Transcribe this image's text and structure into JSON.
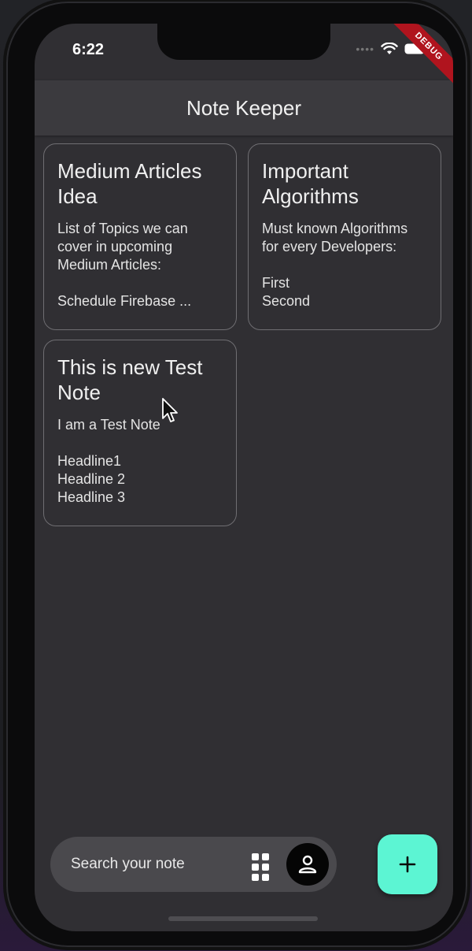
{
  "status_bar": {
    "time": "6:22",
    "debug_label": "DEBUG"
  },
  "app_bar": {
    "title": "Note Keeper"
  },
  "notes": [
    {
      "title": "Medium Articles Idea",
      "body": "List of Topics we can cover in upcoming Medium Articles:\n\nSchedule Firebase ..."
    },
    {
      "title": "Important Algorithms",
      "body": "Must known Algorithms for every Developers:\n\nFirst\nSecond"
    },
    {
      "title": "This is new Test Note",
      "body": "I am a Test Note\n\nHeadline1\nHeadline 2\nHeadline 3"
    }
  ],
  "search": {
    "placeholder": "Search your note"
  },
  "icons": {
    "grid": "grid-view-icon",
    "avatar": "person-icon",
    "fab": "plus-icon",
    "wifi": "wifi-icon",
    "battery": "battery-icon"
  },
  "colors": {
    "background": "#302f33",
    "app_bar": "#3b3a3e",
    "fab": "#5cf5d3",
    "card_border": "#6f6e72",
    "debug": "#b0141e"
  }
}
